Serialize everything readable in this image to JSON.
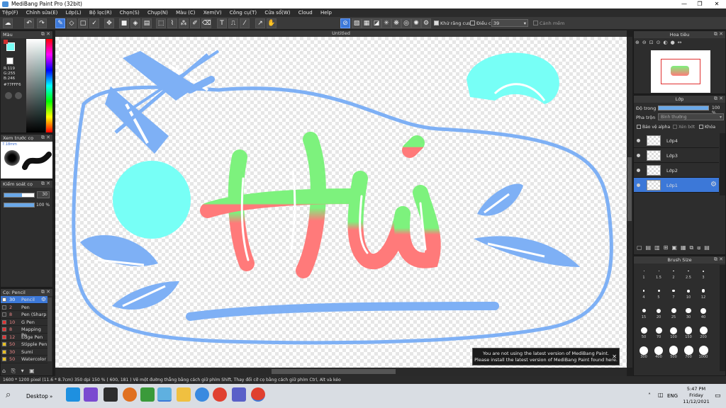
{
  "window": {
    "title": "MediBang Paint Pro (32bit)",
    "min": "—",
    "max": "❐",
    "close": "✕"
  },
  "menu": [
    "Tệp(F)",
    "Chỉnh sửa(E)",
    "Lớp(L)",
    "Bộ lọc(R)",
    "Chọn(S)",
    "Chụp(N)",
    "Màu (C)",
    "Xem(V)",
    "Công cụ(T)",
    "Cửa sổ(W)",
    "Cloud",
    "Help"
  ],
  "toolbar": {
    "antialias_label": "Khử răng cưa",
    "adjust_label": "Điều chỉnh",
    "adjust_value": "39",
    "warning_label": "Cảnh mềm"
  },
  "document": {
    "tab_title": "Untitled"
  },
  "color_panel": {
    "title": "Màu",
    "r": "R:119",
    "g": "G:255",
    "b": "B:246",
    "hex": "#77FFF6",
    "fg_color": "#77fff6",
    "bg_color": "#ffffff"
  },
  "brush_preview": {
    "title": "Xem trước cọ",
    "size": "7.18mm"
  },
  "brush_control": {
    "title": "Kiểm soát cọ",
    "size_value": "30",
    "opacity_value": "100 %"
  },
  "brush_list": {
    "title": "Cọ: Pencil",
    "items": [
      {
        "num": "30",
        "name": "Pencil",
        "color": "#ffffff",
        "selected": true
      },
      {
        "num": "2",
        "name": "Pen",
        "color": "#333333"
      },
      {
        "num": "8",
        "name": "Pen (Sharp",
        "color": "#333333"
      },
      {
        "num": "10",
        "name": "G Pen",
        "color": "#e03030"
      },
      {
        "num": "8",
        "name": "Mapping Pe",
        "color": "#e03030"
      },
      {
        "num": "12",
        "name": "Edge Pen",
        "color": "#e03030"
      },
      {
        "num": "50",
        "name": "Stipple Pen",
        "color": "#e8c020"
      },
      {
        "num": "30",
        "name": "Sumi",
        "color": "#e8c020"
      },
      {
        "num": "50",
        "name": "Watercolor",
        "color": "#e8c020"
      }
    ]
  },
  "navigator": {
    "title": "Hoa tiêu"
  },
  "layers_panel": {
    "title": "Lớp",
    "opacity_label": "Độ trong",
    "opacity_value": "100 %",
    "blend_label": "Pha trộn",
    "blend_value": "Bình thường",
    "protect_alpha": "Bảo vệ alpha",
    "clipping": "Xén bớt",
    "lock": "Khóa",
    "layers": [
      {
        "name": "Lớp4",
        "selected": false
      },
      {
        "name": "Lớp3",
        "selected": false
      },
      {
        "name": "Lớp2",
        "selected": false
      },
      {
        "name": "Lớp1",
        "selected": true
      }
    ]
  },
  "brush_size_panel": {
    "title": "Brush Size",
    "sizes": [
      "1",
      "1.5",
      "2",
      "2.5",
      "3",
      "4",
      "5",
      "7",
      "10",
      "12",
      "15",
      "20",
      "25",
      "30",
      "40",
      "50",
      "70",
      "100",
      "150",
      "200",
      "300",
      "400",
      "500",
      "700",
      "1000"
    ]
  },
  "notice": {
    "line1": "You are not using the latest version of MediBang Paint.",
    "line2": "Please install the latest version of MediBang Paint found here.",
    "close": "✕"
  },
  "status": {
    "info": "1600 * 1200 pixel   (11.6 * 8.7cm)  350 dpi   150 %   ( 600, 181 )   Vẽ một đường thẳng bằng cách giữ phím Shift, Thay đổi cỡ cọ bằng cách giữ phím Ctrl, Alt và kéo"
  },
  "taskbar": {
    "desktop_label": "Desktop",
    "lang": "ENG",
    "time": "5:47 PM",
    "day": "Friday",
    "date": "11/12/2021"
  },
  "colors": {
    "accent": "#3c78d8",
    "blue_stroke": "#7eb0f5",
    "cyan": "#77fff6",
    "green": "#7df27d",
    "red": "#ff7a7a"
  }
}
